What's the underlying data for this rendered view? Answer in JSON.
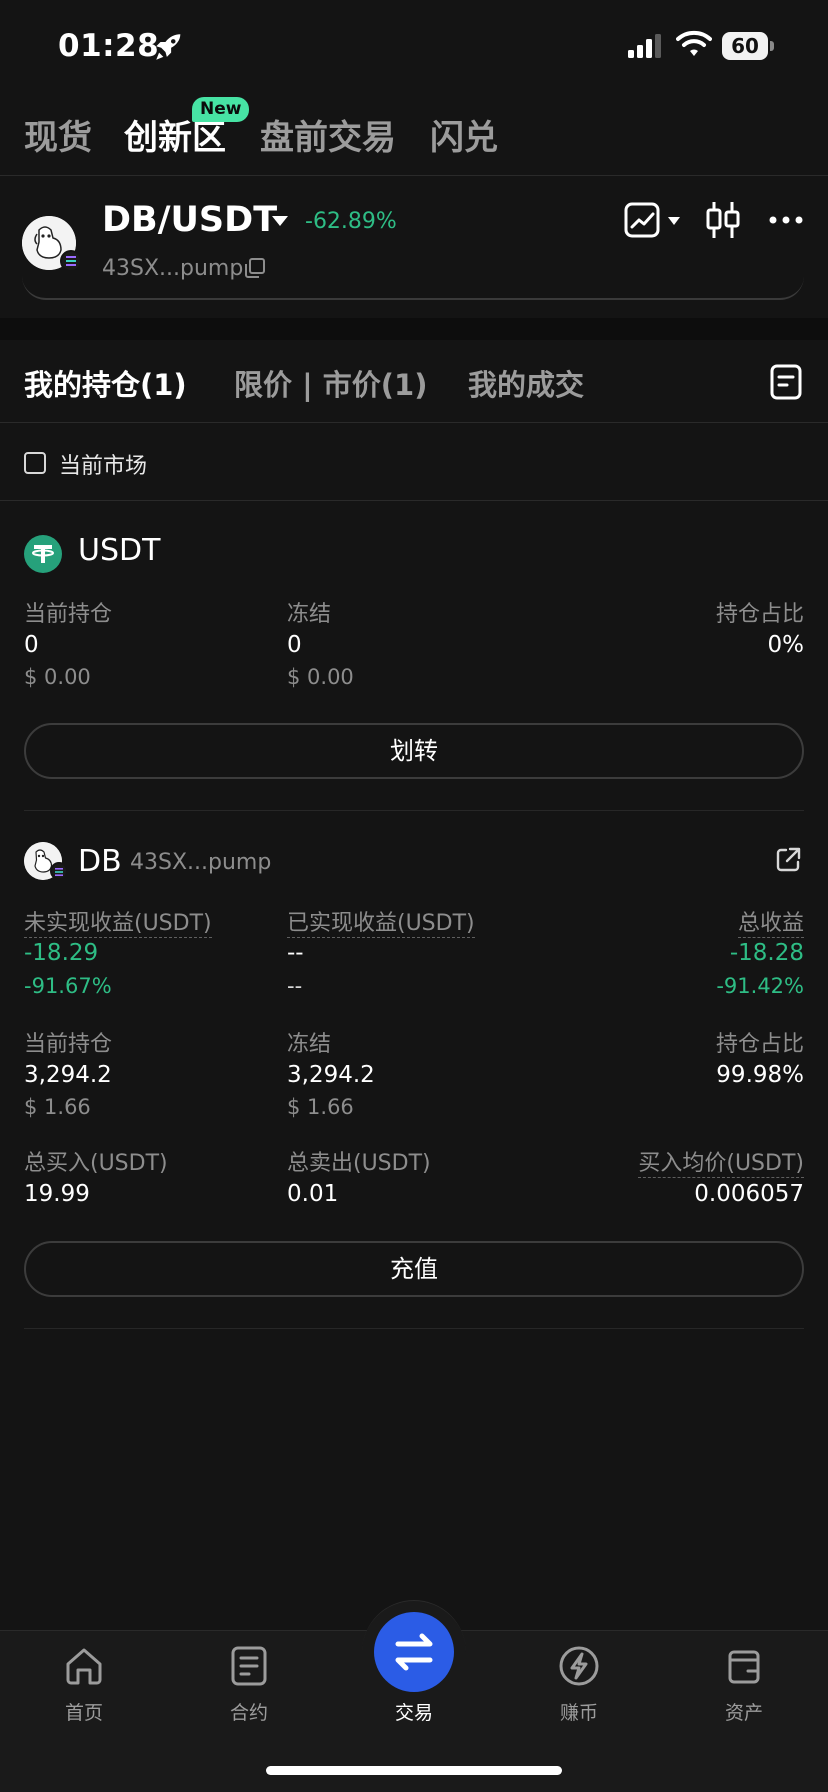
{
  "status_bar": {
    "time": "01:28",
    "battery": "60"
  },
  "top_tabs": [
    {
      "label": "现货"
    },
    {
      "label": "创新区",
      "badge": "New"
    },
    {
      "label": "盘前交易"
    },
    {
      "label": "闪兑"
    }
  ],
  "pair": {
    "name": "DB/USDT",
    "change": "-62.89%",
    "address": "43SX...pump"
  },
  "order_tabs": [
    {
      "label": "我的持仓(1)"
    },
    {
      "label": "限价 | 市价(1)"
    },
    {
      "label": "我的成交"
    }
  ],
  "filter": {
    "current_market_label": "当前市场"
  },
  "usdt_asset": {
    "title": "USDT",
    "holding_label": "当前持仓",
    "holding_value": "0",
    "holding_usd": "$ 0.00",
    "frozen_label": "冻结",
    "frozen_value": "0",
    "frozen_usd": "$ 0.00",
    "ratio_label": "持仓占比",
    "ratio_value": "0%",
    "transfer_button": "划转"
  },
  "db_asset": {
    "title": "DB",
    "address": "43SX...pump",
    "unrealized_label": "未实现收益(USDT)",
    "unrealized_value": "-18.29",
    "unrealized_pct": "-91.67%",
    "realized_label": "已实现收益(USDT)",
    "realized_value": "--",
    "realized_pct": "--",
    "total_label": "总收益",
    "total_value": "-18.28",
    "total_pct": "-91.42%",
    "holding_label": "当前持仓",
    "holding_value": "3,294.2",
    "holding_usd": "$ 1.66",
    "frozen_label": "冻结",
    "frozen_value": "3,294.2",
    "frozen_usd": "$ 1.66",
    "ratio_label": "持仓占比",
    "ratio_value": "99.98%",
    "buy_label": "总买入(USDT)",
    "buy_value": "19.99",
    "sell_label": "总卖出(USDT)",
    "sell_value": "0.01",
    "avg_label": "买入均价(USDT)",
    "avg_value": "0.006057",
    "deposit_button": "充值"
  },
  "bottom_nav": [
    {
      "label": "首页",
      "icon": "home-icon"
    },
    {
      "label": "合约",
      "icon": "contract-icon"
    },
    {
      "label": "交易",
      "icon": "swap-icon"
    },
    {
      "label": "赚币",
      "icon": "earn-icon"
    },
    {
      "label": "资产",
      "icon": "wallet-icon"
    }
  ],
  "colors": {
    "positive": "#2ebd85",
    "accent": "#2b5ce6",
    "badge": "#47e3a4"
  }
}
